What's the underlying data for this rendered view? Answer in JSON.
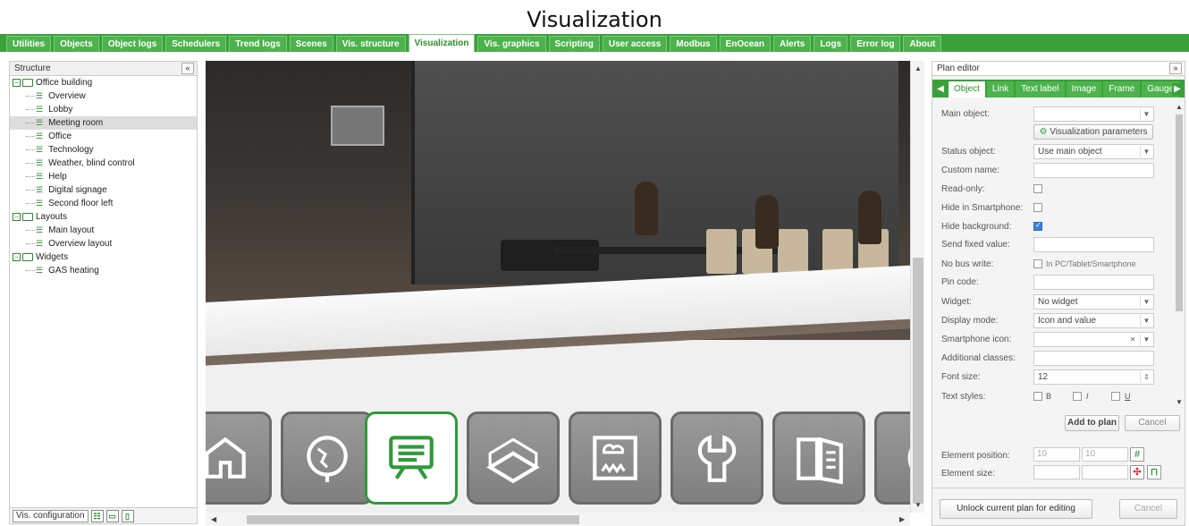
{
  "page_title": "Visualization",
  "tabs": [
    "Utilities",
    "Objects",
    "Object logs",
    "Schedulers",
    "Trend logs",
    "Scenes",
    "Vis. structure",
    "Visualization",
    "Vis. graphics",
    "Scripting",
    "User access",
    "Modbus",
    "EnOcean",
    "Alerts",
    "Logs",
    "Error log",
    "About"
  ],
  "active_tab": "Visualization",
  "structure": {
    "title": "Structure",
    "collapse": "«",
    "tree": [
      {
        "label": "Office building",
        "type": "folder"
      },
      {
        "label": "Overview",
        "type": "item"
      },
      {
        "label": "Lobby",
        "type": "item"
      },
      {
        "label": "Meeting room",
        "type": "item",
        "selected": true
      },
      {
        "label": "Office",
        "type": "item"
      },
      {
        "label": "Technology",
        "type": "item"
      },
      {
        "label": "Weather, blind control",
        "type": "item"
      },
      {
        "label": "Help",
        "type": "item"
      },
      {
        "label": "Digital signage",
        "type": "item"
      },
      {
        "label": "Second floor left",
        "type": "item"
      },
      {
        "label": "Layouts",
        "type": "folder"
      },
      {
        "label": "Main layout",
        "type": "item"
      },
      {
        "label": "Overview layout",
        "type": "item"
      },
      {
        "label": "Widgets",
        "type": "folder"
      },
      {
        "label": "GAS heating",
        "type": "item"
      }
    ],
    "config_button": "Vis. configuration"
  },
  "plan_editor": {
    "title": "Plan editor",
    "expand": "»",
    "tabs": [
      "Object",
      "Link",
      "Text label",
      "Image",
      "Frame",
      "Gauge"
    ],
    "active_tab": "Object",
    "fields": {
      "main_object": "Main object:",
      "vis_params": "Visualization parameters",
      "status_object": "Status object:",
      "status_object_value": "Use main object",
      "custom_name": "Custom name:",
      "read_only": "Read-only:",
      "hide_smartphone": "Hide in Smartphone:",
      "hide_background": "Hide background:",
      "send_fixed": "Send fixed value:",
      "no_bus_write": "No bus write:",
      "no_bus_write_opt": "In PC/Tablet/Smartphone",
      "pin_code": "Pin code:",
      "widget": "Widget:",
      "widget_value": "No widget",
      "display_mode": "Display mode:",
      "display_mode_value": "Icon and value",
      "smartphone_icon": "Smartphone icon:",
      "additional_classes": "Additional classes:",
      "font_size": "Font size:",
      "font_size_value": "12",
      "text_styles": "Text styles:",
      "style_b": "B",
      "style_i": "I",
      "style_u": "U"
    },
    "add_to_plan": "Add to plan",
    "cancel": "Cancel",
    "element_position": "Element position:",
    "element_size": "Element size:",
    "pos_x": "10",
    "pos_y": "10",
    "unlock": "Unlock current plan for editing",
    "cancel2": "Cancel"
  },
  "colors": {
    "accent": "#3aa13a",
    "active_icon": "#2e9a3a"
  }
}
